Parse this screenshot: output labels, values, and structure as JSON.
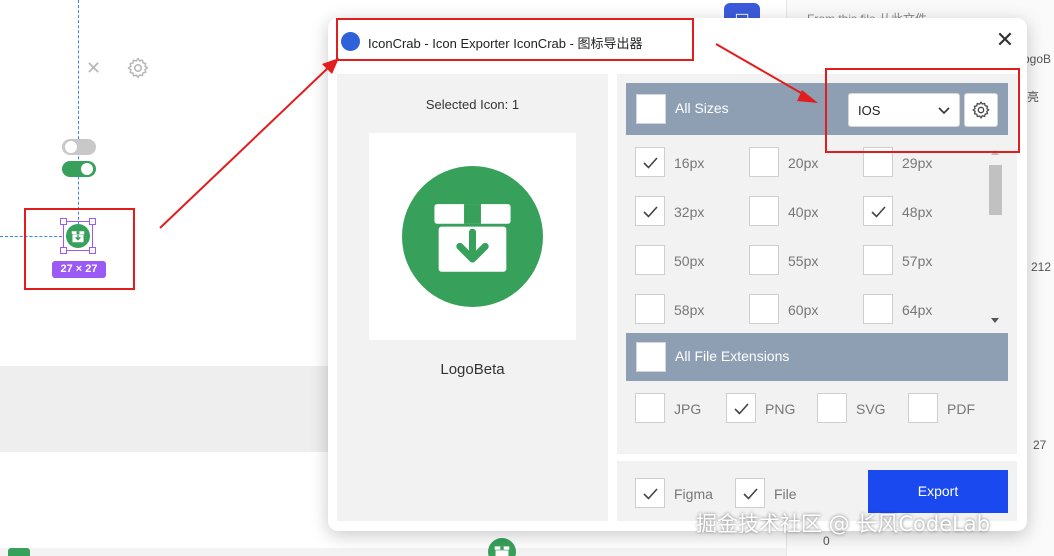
{
  "canvas": {
    "selection_size": "27 × 27",
    "bottom_right_label": "0"
  },
  "right_panel": {
    "top_text": "From this file 从此文件",
    "side_values": [
      "ogoB",
      "亮",
      "212",
      "27"
    ]
  },
  "plugin": {
    "title": "IconCrab - Icon Exporter IconCrab - 图标导出器",
    "selected_label": "Selected Icon: 1",
    "icon_name": "LogoBeta",
    "sizes_section": {
      "label": "All Sizes",
      "checked": false,
      "platform_selected": "IOS",
      "items": [
        {
          "label": "16px",
          "checked": true
        },
        {
          "label": "20px",
          "checked": false
        },
        {
          "label": "29px",
          "checked": false
        },
        {
          "label": "32px",
          "checked": true
        },
        {
          "label": "40px",
          "checked": false
        },
        {
          "label": "48px",
          "checked": true
        },
        {
          "label": "50px",
          "checked": false
        },
        {
          "label": "55px",
          "checked": false
        },
        {
          "label": "57px",
          "checked": false
        },
        {
          "label": "58px",
          "checked": false
        },
        {
          "label": "60px",
          "checked": false
        },
        {
          "label": "64px",
          "checked": false
        }
      ]
    },
    "extensions_section": {
      "label": "All File Extensions",
      "checked": false,
      "items": [
        {
          "label": "JPG",
          "checked": false
        },
        {
          "label": "PNG",
          "checked": true
        },
        {
          "label": "SVG",
          "checked": false
        },
        {
          "label": "PDF",
          "checked": false
        }
      ]
    },
    "destinations": [
      {
        "label": "Figma",
        "checked": true
      },
      {
        "label": "File",
        "checked": true
      }
    ],
    "export_label": "Export"
  },
  "watermark": "掘金技术社区 @ 长风CodeLab",
  "colors": {
    "icon_green": "#37a05a",
    "section_bar": "#8e9fb4",
    "export_blue": "#1a49ef",
    "annotation_red": "#e11d1d",
    "selection_purple": "#9b59f5"
  }
}
